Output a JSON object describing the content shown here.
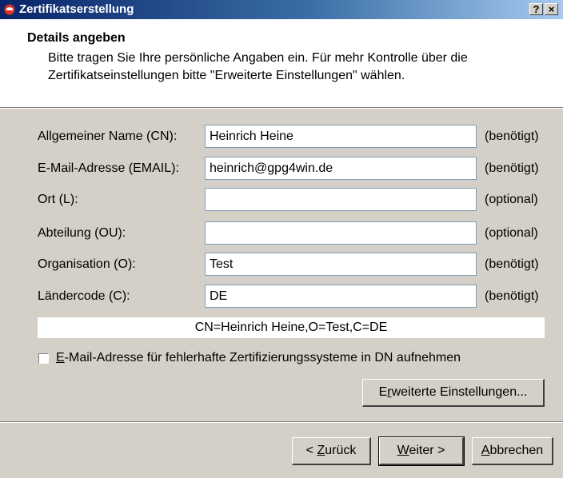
{
  "window": {
    "title": "Zertifikatserstellung",
    "help_label": "?",
    "close_label": "×"
  },
  "header": {
    "title": "Details angeben",
    "description": "Bitte tragen Sie Ihre persönliche Angaben ein. Für mehr Kontrolle über die Zertifikatseinstellungen bitte \"Erweiterte Einstellungen\" wählen."
  },
  "fields": [
    {
      "label": "Allgemeiner Name (CN):",
      "value": "Heinrich Heine",
      "status": "(benötigt)"
    },
    {
      "label": "E-Mail-Adresse (EMAIL):",
      "value": "heinrich@gpg4win.de",
      "status": "(benötigt)"
    },
    {
      "label": "Ort (L):",
      "value": "",
      "status": "(optional)"
    },
    {
      "label": "Abteilung (OU):",
      "value": "",
      "status": "(optional)"
    },
    {
      "label": "Organisation (O):",
      "value": "Test",
      "status": "(benötigt)"
    },
    {
      "label": "Ländercode (C):",
      "value": "DE",
      "status": "(benötigt)"
    }
  ],
  "dn_preview": "CN=Heinrich Heine,O=Test,C=DE",
  "checkbox": {
    "label_mnemonic": "E",
    "label_rest": "-Mail-Adresse für fehlerhafte Zertifizierungssysteme in DN aufnehmen",
    "checked": false
  },
  "advanced_button": {
    "pre": "E",
    "mnemonic": "r",
    "post": "weiterte Einstellungen..."
  },
  "buttons": {
    "back": {
      "pre": "< ",
      "mnemonic": "Z",
      "post": "urück"
    },
    "next": {
      "pre": "",
      "mnemonic": "W",
      "post": "eiter >"
    },
    "cancel": {
      "pre": "",
      "mnemonic": "A",
      "post": "bbrechen"
    }
  }
}
